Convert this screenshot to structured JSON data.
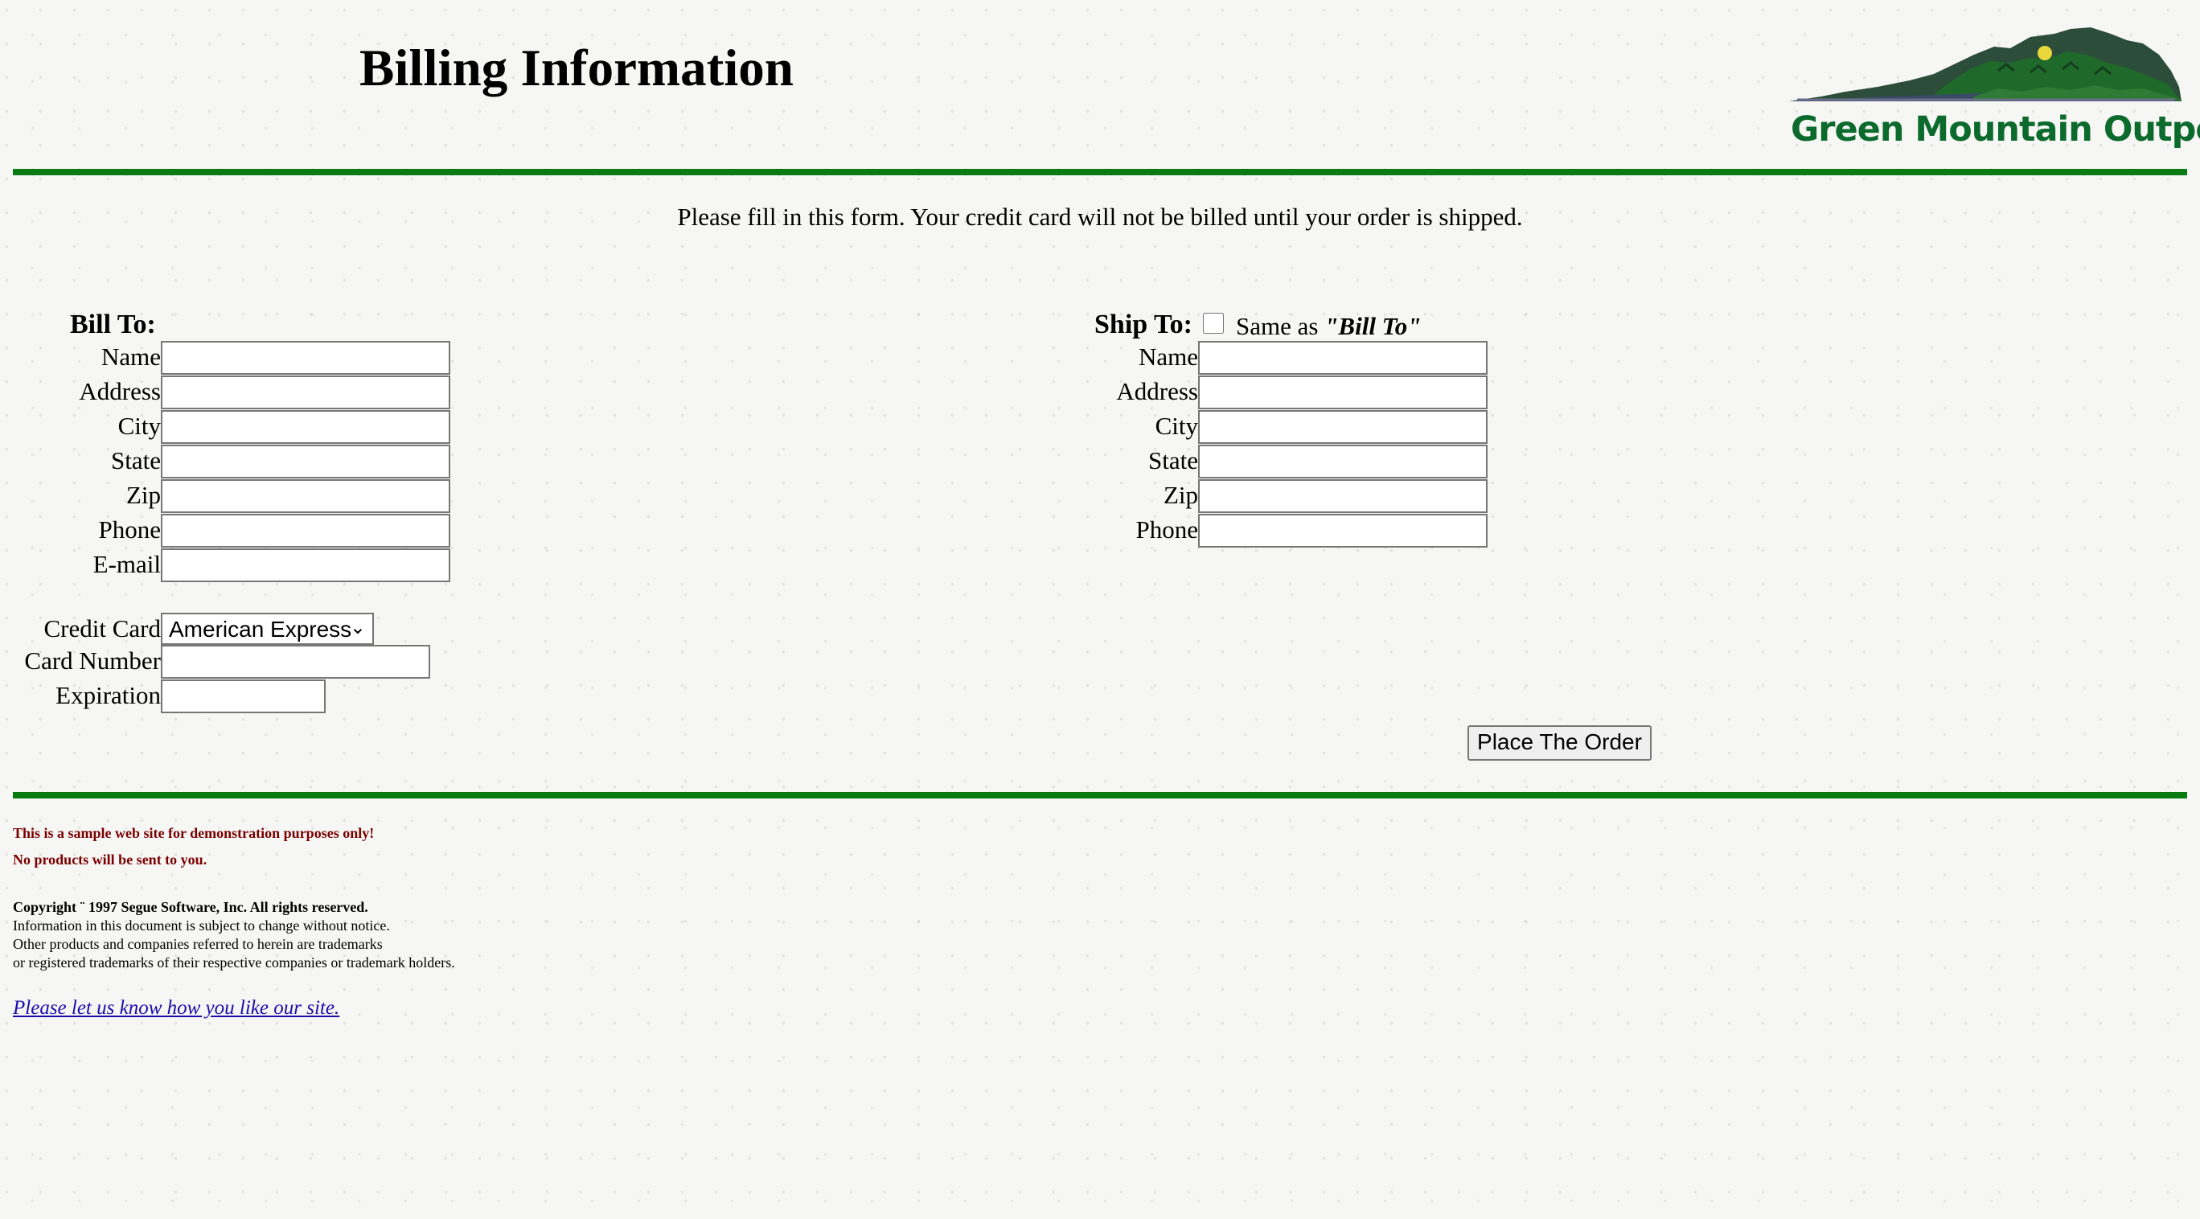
{
  "header": {
    "title": "Billing Information",
    "logo_text": "Green Mountain Outpost"
  },
  "intro": "Please fill in this form. Your credit card will not be billed until your order is shipped.",
  "bill_to": {
    "heading": "Bill To:",
    "fields": [
      "Name",
      "Address",
      "City",
      "State",
      "Zip",
      "Phone",
      "E-mail"
    ]
  },
  "ship_to": {
    "heading": "Ship To:",
    "same_as_prefix": "Same as ",
    "same_as_emphasis": "\"Bill To\"",
    "same_as_checked": false,
    "fields": [
      "Name",
      "Address",
      "City",
      "State",
      "Zip",
      "Phone"
    ]
  },
  "payment": {
    "credit_card_label": "Credit Card",
    "credit_card_selected": "American Express",
    "card_number_label": "Card Number",
    "expiration_label": "Expiration"
  },
  "submit_label": "Place The Order",
  "footer": {
    "disclaimer_1": "This is a sample web site for demonstration purposes only!",
    "disclaimer_2": "No products will be sent to you.",
    "copyright_head": "Copyright ¨ 1997 Segue Software, Inc. All rights reserved.",
    "copyright_lines": [
      "Information in this document is subject to change without notice.",
      "Other products and companies referred to herein are trademarks",
      "or registered trademarks of their respective companies or trademark holders."
    ],
    "feedback_link": "Please let us know how you like our site."
  },
  "colors": {
    "rule": "#0a7a12",
    "disclaimer": "#7a0000",
    "link": "#1a0dab",
    "logo_text": "#0c6b2c"
  }
}
